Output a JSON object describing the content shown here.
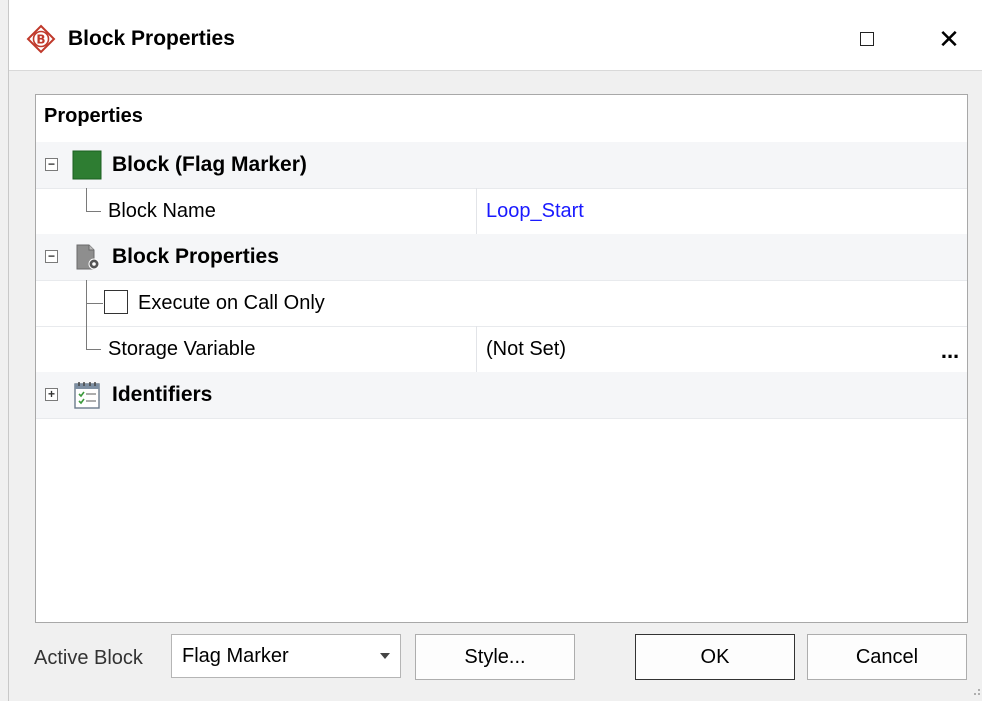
{
  "window": {
    "title": "Block Properties",
    "app_icon": "b-diamond-icon",
    "maximize_icon": "maximize-icon",
    "close_label": "✕"
  },
  "grid": {
    "header": "Properties",
    "categories": [
      {
        "label": "Block (Flag Marker)",
        "expander": "−",
        "icon": "green-square-icon",
        "properties": [
          {
            "label": "Block Name",
            "value": "Loop_Start"
          }
        ]
      },
      {
        "label": "Block Properties",
        "expander": "−",
        "icon": "document-gear-icon",
        "properties": [
          {
            "label": "Execute on Call Only",
            "checked": false
          },
          {
            "label": "Storage Variable",
            "value": "(Not Set)",
            "button": "..."
          }
        ]
      },
      {
        "label": "Identifiers",
        "expander": "+",
        "icon": "calendar-checklist-icon"
      }
    ]
  },
  "footer": {
    "active_block_label": "Active Block",
    "active_block_value": "Flag Marker",
    "style_button": "Style...",
    "ok_button": "OK",
    "cancel_button": "Cancel"
  },
  "colors": {
    "link": "#1a1aff",
    "flag_marker": "#2e7d32",
    "app_icon": "#c0392b"
  }
}
